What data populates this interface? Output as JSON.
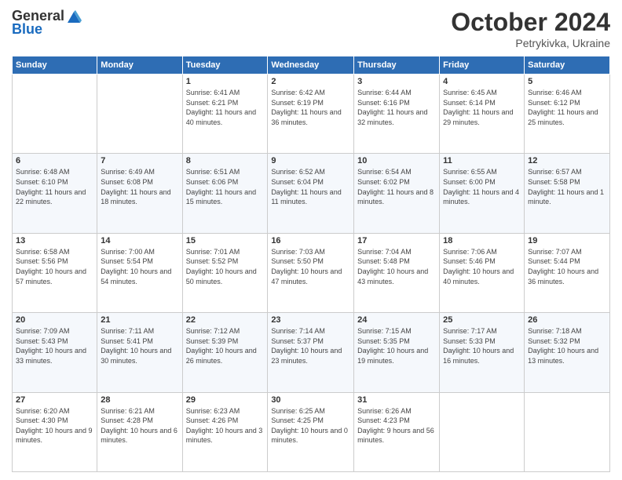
{
  "header": {
    "logo_general": "General",
    "logo_blue": "Blue",
    "month_title": "October 2024",
    "subtitle": "Petrykivka, Ukraine"
  },
  "calendar": {
    "days_of_week": [
      "Sunday",
      "Monday",
      "Tuesday",
      "Wednesday",
      "Thursday",
      "Friday",
      "Saturday"
    ],
    "weeks": [
      [
        {
          "day": "",
          "info": ""
        },
        {
          "day": "",
          "info": ""
        },
        {
          "day": "1",
          "info": "Sunrise: 6:41 AM\nSunset: 6:21 PM\nDaylight: 11 hours and 40 minutes."
        },
        {
          "day": "2",
          "info": "Sunrise: 6:42 AM\nSunset: 6:19 PM\nDaylight: 11 hours and 36 minutes."
        },
        {
          "day": "3",
          "info": "Sunrise: 6:44 AM\nSunset: 6:16 PM\nDaylight: 11 hours and 32 minutes."
        },
        {
          "day": "4",
          "info": "Sunrise: 6:45 AM\nSunset: 6:14 PM\nDaylight: 11 hours and 29 minutes."
        },
        {
          "day": "5",
          "info": "Sunrise: 6:46 AM\nSunset: 6:12 PM\nDaylight: 11 hours and 25 minutes."
        }
      ],
      [
        {
          "day": "6",
          "info": "Sunrise: 6:48 AM\nSunset: 6:10 PM\nDaylight: 11 hours and 22 minutes."
        },
        {
          "day": "7",
          "info": "Sunrise: 6:49 AM\nSunset: 6:08 PM\nDaylight: 11 hours and 18 minutes."
        },
        {
          "day": "8",
          "info": "Sunrise: 6:51 AM\nSunset: 6:06 PM\nDaylight: 11 hours and 15 minutes."
        },
        {
          "day": "9",
          "info": "Sunrise: 6:52 AM\nSunset: 6:04 PM\nDaylight: 11 hours and 11 minutes."
        },
        {
          "day": "10",
          "info": "Sunrise: 6:54 AM\nSunset: 6:02 PM\nDaylight: 11 hours and 8 minutes."
        },
        {
          "day": "11",
          "info": "Sunrise: 6:55 AM\nSunset: 6:00 PM\nDaylight: 11 hours and 4 minutes."
        },
        {
          "day": "12",
          "info": "Sunrise: 6:57 AM\nSunset: 5:58 PM\nDaylight: 11 hours and 1 minute."
        }
      ],
      [
        {
          "day": "13",
          "info": "Sunrise: 6:58 AM\nSunset: 5:56 PM\nDaylight: 10 hours and 57 minutes."
        },
        {
          "day": "14",
          "info": "Sunrise: 7:00 AM\nSunset: 5:54 PM\nDaylight: 10 hours and 54 minutes."
        },
        {
          "day": "15",
          "info": "Sunrise: 7:01 AM\nSunset: 5:52 PM\nDaylight: 10 hours and 50 minutes."
        },
        {
          "day": "16",
          "info": "Sunrise: 7:03 AM\nSunset: 5:50 PM\nDaylight: 10 hours and 47 minutes."
        },
        {
          "day": "17",
          "info": "Sunrise: 7:04 AM\nSunset: 5:48 PM\nDaylight: 10 hours and 43 minutes."
        },
        {
          "day": "18",
          "info": "Sunrise: 7:06 AM\nSunset: 5:46 PM\nDaylight: 10 hours and 40 minutes."
        },
        {
          "day": "19",
          "info": "Sunrise: 7:07 AM\nSunset: 5:44 PM\nDaylight: 10 hours and 36 minutes."
        }
      ],
      [
        {
          "day": "20",
          "info": "Sunrise: 7:09 AM\nSunset: 5:43 PM\nDaylight: 10 hours and 33 minutes."
        },
        {
          "day": "21",
          "info": "Sunrise: 7:11 AM\nSunset: 5:41 PM\nDaylight: 10 hours and 30 minutes."
        },
        {
          "day": "22",
          "info": "Sunrise: 7:12 AM\nSunset: 5:39 PM\nDaylight: 10 hours and 26 minutes."
        },
        {
          "day": "23",
          "info": "Sunrise: 7:14 AM\nSunset: 5:37 PM\nDaylight: 10 hours and 23 minutes."
        },
        {
          "day": "24",
          "info": "Sunrise: 7:15 AM\nSunset: 5:35 PM\nDaylight: 10 hours and 19 minutes."
        },
        {
          "day": "25",
          "info": "Sunrise: 7:17 AM\nSunset: 5:33 PM\nDaylight: 10 hours and 16 minutes."
        },
        {
          "day": "26",
          "info": "Sunrise: 7:18 AM\nSunset: 5:32 PM\nDaylight: 10 hours and 13 minutes."
        }
      ],
      [
        {
          "day": "27",
          "info": "Sunrise: 6:20 AM\nSunset: 4:30 PM\nDaylight: 10 hours and 9 minutes."
        },
        {
          "day": "28",
          "info": "Sunrise: 6:21 AM\nSunset: 4:28 PM\nDaylight: 10 hours and 6 minutes."
        },
        {
          "day": "29",
          "info": "Sunrise: 6:23 AM\nSunset: 4:26 PM\nDaylight: 10 hours and 3 minutes."
        },
        {
          "day": "30",
          "info": "Sunrise: 6:25 AM\nSunset: 4:25 PM\nDaylight: 10 hours and 0 minutes."
        },
        {
          "day": "31",
          "info": "Sunrise: 6:26 AM\nSunset: 4:23 PM\nDaylight: 9 hours and 56 minutes."
        },
        {
          "day": "",
          "info": ""
        },
        {
          "day": "",
          "info": ""
        }
      ]
    ]
  }
}
